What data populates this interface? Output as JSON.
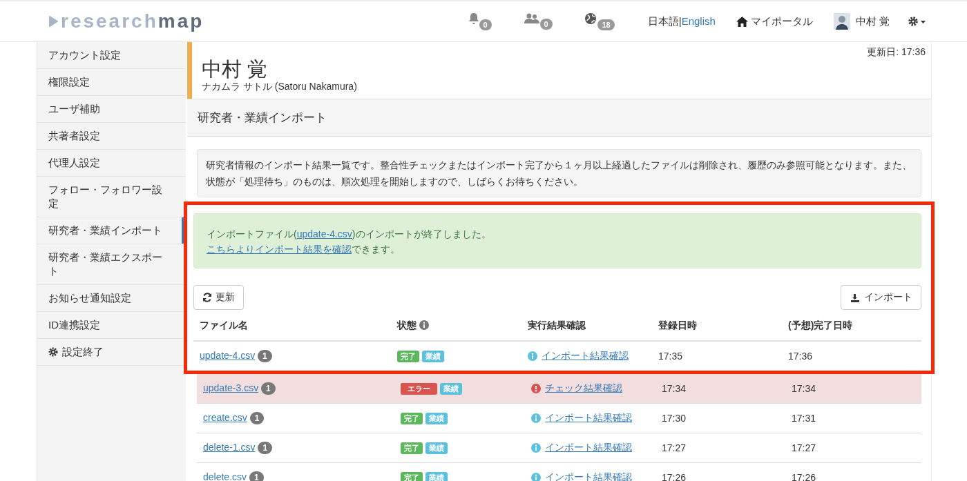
{
  "header": {
    "logo": "research**map**",
    "notifications": "0",
    "contacts": "0",
    "globe": "18",
    "lang_current": "日本語",
    "lang_separator": "|",
    "lang_other": "English",
    "portal": "マイポータル",
    "user": "中村 覚"
  },
  "sidebar": {
    "items": [
      {
        "label": "アカウント設定",
        "selected": false,
        "kind": "text"
      },
      {
        "label": "権限設定",
        "selected": false,
        "kind": "text"
      },
      {
        "label": "ユーザ補助",
        "selected": false,
        "kind": "text"
      },
      {
        "label": "共著者設定",
        "selected": false,
        "kind": "text"
      },
      {
        "label": "代理人設定",
        "selected": false,
        "kind": "text"
      },
      {
        "label": "フォロー・フォロワー設定",
        "selected": false,
        "kind": "text"
      },
      {
        "label": "研究者・業績インポート",
        "selected": true,
        "kind": "text"
      },
      {
        "label": "研究者・業績エクスポート",
        "selected": false,
        "kind": "text"
      },
      {
        "label": "お知らせ通知設定",
        "selected": false,
        "kind": "text"
      },
      {
        "label": "ID連携設定",
        "selected": false,
        "kind": "text"
      },
      {
        "label": "設定終了",
        "selected": false,
        "kind": "gear"
      }
    ]
  },
  "profile": {
    "updated": "更新日: 17:36",
    "name": "中村 覚",
    "kana": "ナカムラ サトル  (Satoru Nakamura)"
  },
  "section_title": "研究者・業績インポート",
  "notice": "研究者情報のインポート結果一覧です。整合性チェックまたはインポート完了から１ヶ月以上経過したファイルは削除され、履歴のみ参照可能となります。また、状態が「処理待ち」のものは、順次処理を開始しますので、しばらくお待ちください。",
  "alert": {
    "before": "インポートファイル(",
    "file": "update-4.csv",
    "after": ")のインポートが終了しました。",
    "link": "こちらよりインポート結果を確認",
    "tail": "できます。"
  },
  "buttons": {
    "refresh": "更新",
    "import": "インポート"
  },
  "table": {
    "columns": [
      "ファイル名",
      "状態",
      "実行結果確認",
      "登録日時",
      "(予想)完了日時"
    ],
    "rows": [
      {
        "file": "update-4.csv",
        "count": "1",
        "kind": "done",
        "status": "完了",
        "category": "業績",
        "result": "インポート結果確認",
        "registered": "17:35",
        "completed": "17:36"
      },
      {
        "file": "update-3.csv",
        "count": "1",
        "kind": "error",
        "status": "エラー",
        "category": "業績",
        "result": "チェック結果確認",
        "registered": "17:34",
        "completed": "17:34"
      },
      {
        "file": "create.csv",
        "count": "1",
        "kind": "done",
        "status": "完了",
        "category": "業績",
        "result": "インポート結果確認",
        "registered": "17:30",
        "completed": "17:31"
      },
      {
        "file": "delete-1.csv",
        "count": "1",
        "kind": "done",
        "status": "完了",
        "category": "業績",
        "result": "インポート結果確認",
        "registered": "17:27",
        "completed": "17:27"
      },
      {
        "file": "delete.csv",
        "count": "1",
        "kind": "done",
        "status": "完了",
        "category": "業績",
        "result": "インポート結果確認",
        "registered": "17:26",
        "completed": "17:26"
      }
    ]
  }
}
